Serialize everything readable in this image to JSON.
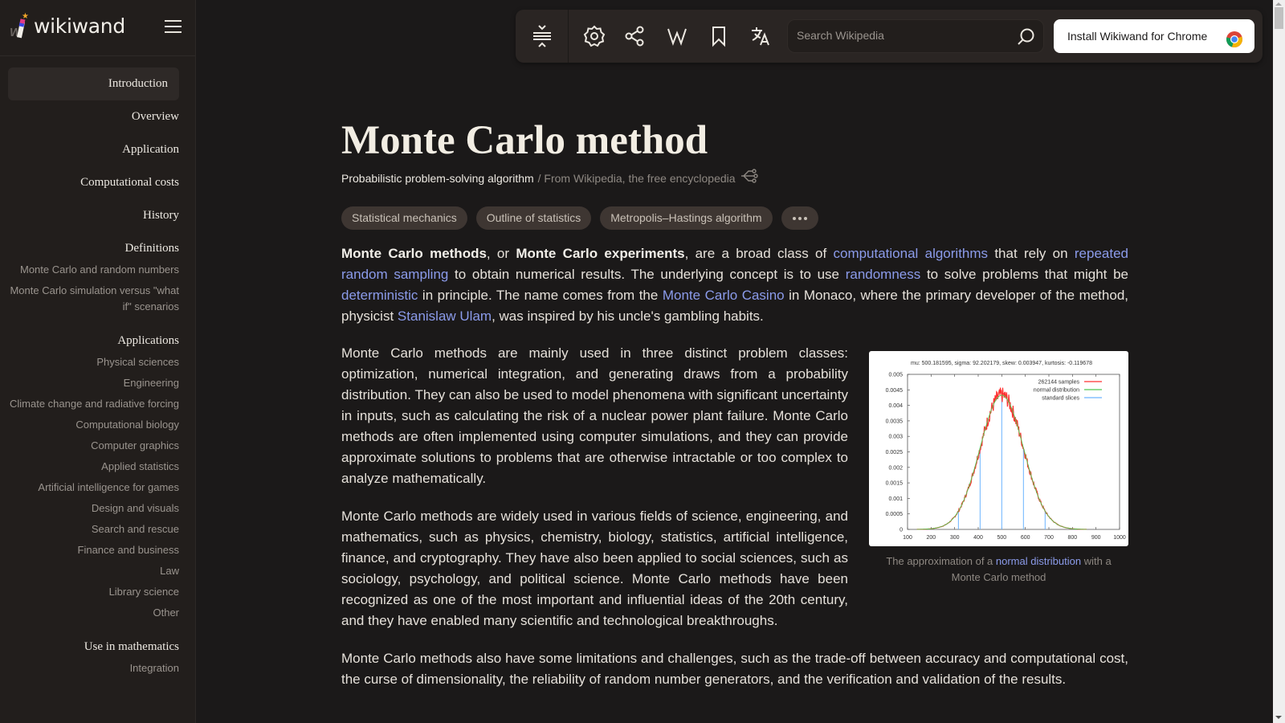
{
  "app": {
    "logo_text": "wikiwand"
  },
  "sidebar": {
    "toc": [
      {
        "label": "Introduction",
        "level": 1,
        "active": true
      },
      {
        "label": "Overview",
        "level": 1
      },
      {
        "label": "Application",
        "level": 1
      },
      {
        "label": "Computational costs",
        "level": 1
      },
      {
        "label": "History",
        "level": 1
      },
      {
        "label": "Definitions",
        "level": 1
      },
      {
        "label": "Monte Carlo and random numbers",
        "level": 2
      },
      {
        "label": "Monte Carlo simulation versus \"what if\" scenarios",
        "level": 2
      },
      {
        "label": "Applications",
        "level": 1
      },
      {
        "label": "Physical sciences",
        "level": 2
      },
      {
        "label": "Engineering",
        "level": 2
      },
      {
        "label": "Climate change and radiative forcing",
        "level": 2
      },
      {
        "label": "Computational biology",
        "level": 2
      },
      {
        "label": "Computer graphics",
        "level": 2
      },
      {
        "label": "Applied statistics",
        "level": 2
      },
      {
        "label": "Artificial intelligence for games",
        "level": 2
      },
      {
        "label": "Design and visuals",
        "level": 2
      },
      {
        "label": "Search and rescue",
        "level": 2
      },
      {
        "label": "Finance and business",
        "level": 2
      },
      {
        "label": "Law",
        "level": 2
      },
      {
        "label": "Library science",
        "level": 2
      },
      {
        "label": "Other",
        "level": 2
      },
      {
        "label": "Use in mathematics",
        "level": 1
      },
      {
        "label": "Integration",
        "level": 2
      }
    ]
  },
  "toolbar": {
    "icons": [
      "collapse-expand-icon",
      "settings-icon",
      "share-icon",
      "wikipedia-icon",
      "bookmark-icon",
      "translate-icon"
    ],
    "search_placeholder": "Search Wikipedia",
    "install_label": "Install Wikiwand for Chrome"
  },
  "article": {
    "title": "Monte Carlo method",
    "description": "Probabilistic problem-solving algorithm",
    "source": "/ From Wikipedia, the free encyclopedia",
    "chips": [
      "Statistical mechanics",
      "Outline of statistics",
      "Metropolis–Hastings algorithm"
    ],
    "more_label": "•••",
    "p1": {
      "b1": "Monte Carlo methods",
      "t1": ", or ",
      "b2": "Monte Carlo experiments",
      "t2": ", are a broad class of ",
      "l1": "computational algorithms",
      "t3": " that rely on ",
      "l2": "repeated random sampling",
      "t4": " to obtain numerical results. The underlying concept is to use ",
      "l3": "randomness",
      "t5": " to solve problems that might be ",
      "l4": "deterministic",
      "t6": " in principle. The name comes from the ",
      "l5": "Monte Carlo Casino",
      "t7": " in Monaco, where the primary developer of the method, physicist ",
      "l6": "Stanislaw Ulam",
      "t8": ", was inspired by his uncle's gambling habits."
    },
    "p2": "Monte Carlo methods are mainly used in three distinct problem classes: optimization, numerical integration, and generating draws from a probability distribution. They can also be used to model phenomena with significant uncertainty in inputs, such as calculating the risk of a nuclear power plant failure. Monte Carlo methods are often implemented using computer simulations, and they can provide approximate solutions to problems that are otherwise intractable or too complex to analyze mathematically.",
    "p3": "Monte Carlo methods are widely used in various fields of science, engineering, and mathematics, such as physics, chemistry, biology, statistics, artificial intelligence, finance, and cryptography. They have also been applied to social sciences, such as sociology, psychology, and political science. Monte Carlo methods have been recognized as one of the most important and influential ideas of the 20th century, and they have enabled many scientific and technological breakthroughs.",
    "p4": "Monte Carlo methods also have some limitations and challenges, such as the trade-off between accuracy and computational cost, the curse of dimensionality, the reliability of random number generators, and the verification and validation of the results.",
    "figure": {
      "caption_pre": "The approximation of a ",
      "caption_link": "normal distribution",
      "caption_post": " with a Monte Carlo method",
      "chart_data": {
        "type": "line",
        "title": "mu: 500.181595,  sigma: 92.202179,  skew: 0.003947,  kurtosis: -0.119678",
        "xlim": [
          100,
          1000
        ],
        "ylim": [
          0,
          0.005
        ],
        "xticks": [
          100,
          200,
          300,
          400,
          500,
          600,
          700,
          800,
          900,
          1000
        ],
        "yticks": [
          "0",
          "0.0005",
          "0.001",
          "0.0015",
          "0.002",
          "0.0025",
          "0.003",
          "0.0035",
          "0.004",
          "0.0045",
          "0.005"
        ],
        "series": [
          {
            "name": "262144 samples",
            "color": "#ff3030",
            "mu": 500.181595,
            "sigma": 92.202179,
            "noisy": true
          },
          {
            "name": "normal distribution",
            "color": "#50c850",
            "mu": 500,
            "sigma": 92.2
          },
          {
            "name": "standard slices",
            "color": "#6cb4ff",
            "x": [
              316,
              408,
              500,
              592,
              684
            ]
          }
        ],
        "legend": "top-right"
      }
    }
  }
}
